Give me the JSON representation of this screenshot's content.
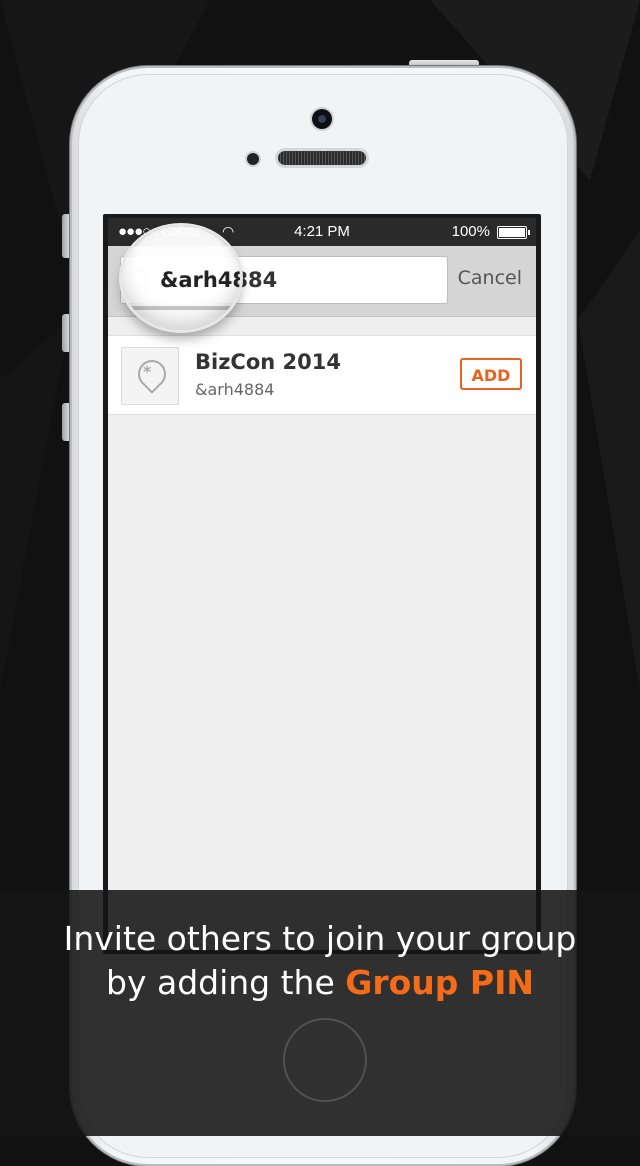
{
  "status_bar": {
    "carrier": "●●●○○ Carrier",
    "wifi_icon": "wifi-icon",
    "time": "4:21 PM",
    "battery": "100%"
  },
  "search": {
    "value": "&arh4884",
    "cancel": "Cancel",
    "icon": "search-icon"
  },
  "results": [
    {
      "name": "BizCon 2014",
      "pin": "&arh4884",
      "action": "ADD",
      "icon": "location-pin-icon"
    }
  ],
  "caption": {
    "line1": "Invite others to join your group",
    "line2_prefix": "by adding the ",
    "highlight": "Group PIN"
  },
  "colors": {
    "accent": "#e8641e",
    "background": "#111111"
  }
}
